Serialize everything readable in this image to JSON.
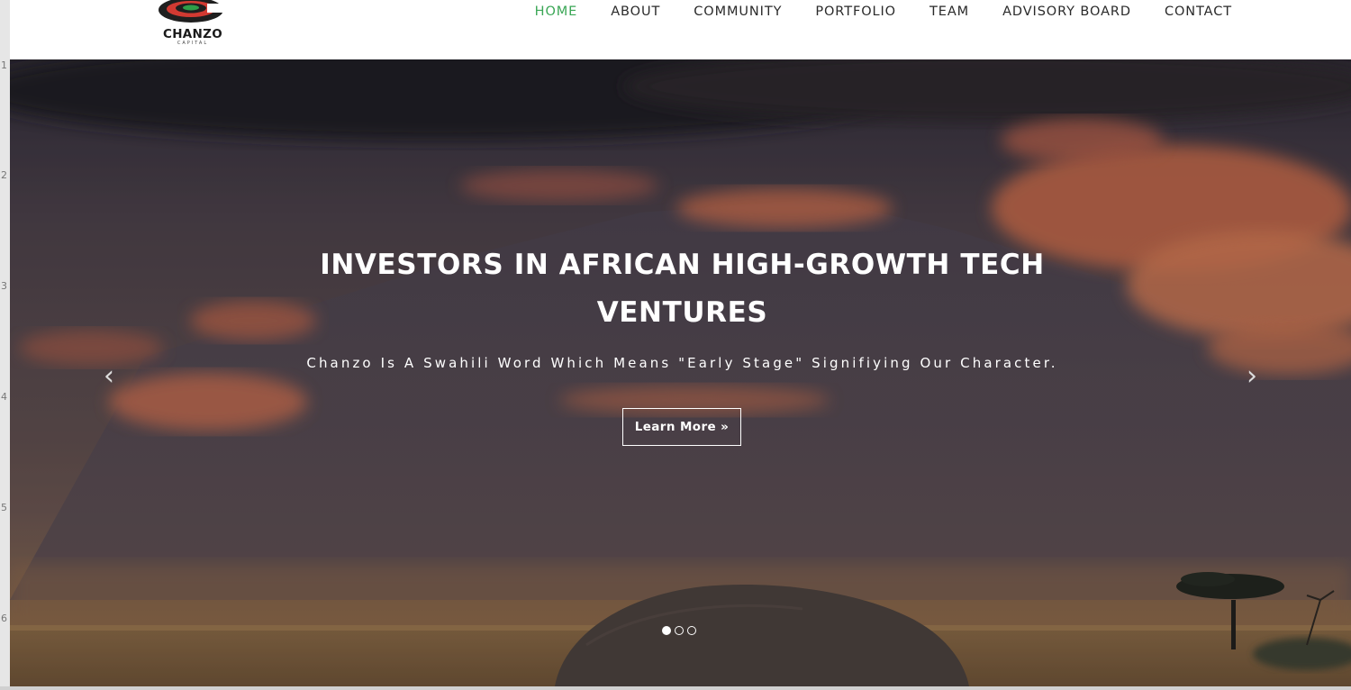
{
  "logo": {
    "name": "CHANZO",
    "sub": "CAPITAL"
  },
  "nav": {
    "items": [
      {
        "label": "HOME",
        "active": true
      },
      {
        "label": "ABOUT",
        "active": false
      },
      {
        "label": "COMMUNITY",
        "active": false
      },
      {
        "label": "PORTFOLIO",
        "active": false
      },
      {
        "label": "TEAM",
        "active": false
      },
      {
        "label": "ADVISORY BOARD",
        "active": false
      },
      {
        "label": "CONTACT",
        "active": false
      }
    ],
    "active_color": "#3aa655"
  },
  "hero": {
    "title_pre": "INVESTORS IN AFRICAN ",
    "title_bold": "HIGH-GROWTH",
    "title_post": " TECH",
    "title_line2": "VENTURES",
    "subtitle": "Chanzo Is A Swahili Word Which Means \"Early Stage\" Signifiying Our Character.",
    "button_label": "Learn More »",
    "arrow_left": "‹",
    "arrow_right": "›",
    "slide_count": 3,
    "active_slide": 1
  },
  "ruler": {
    "marks": [
      "1",
      "2",
      "3",
      "4",
      "5",
      "6"
    ]
  }
}
